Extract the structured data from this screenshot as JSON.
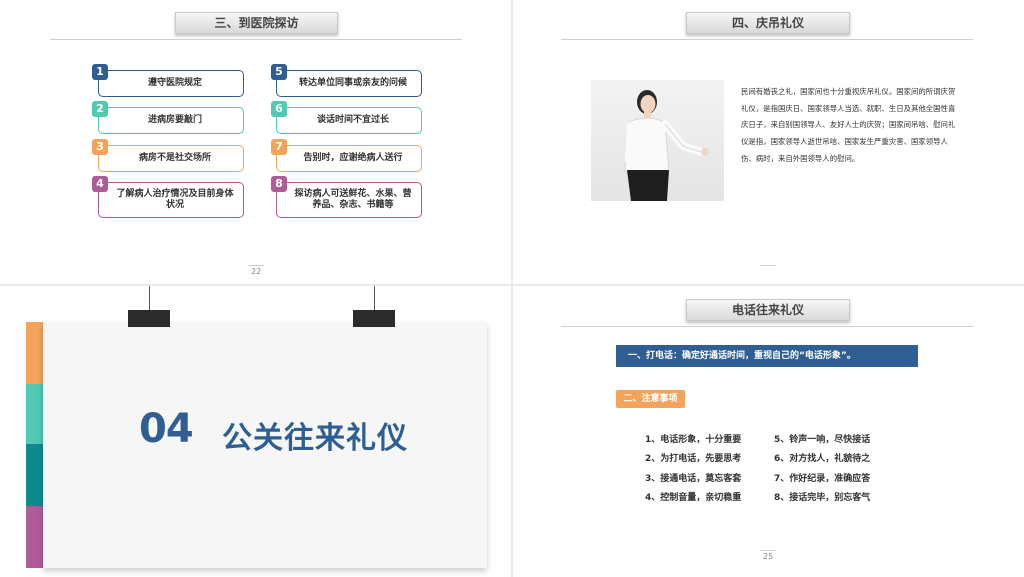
{
  "slide1": {
    "title": "三、到医院探访",
    "page": "22",
    "items": [
      {
        "num": "1",
        "text": "遵守医院规定"
      },
      {
        "num": "2",
        "text": "进病房要敲门"
      },
      {
        "num": "3",
        "text": "病房不是社交场所"
      },
      {
        "num": "4",
        "text": "了解病人治疗情况及目前身体状况"
      },
      {
        "num": "5",
        "text": "转达单位同事或亲友的问候"
      },
      {
        "num": "6",
        "text": "谈话时间不宜过长"
      },
      {
        "num": "7",
        "text": "告别时，应谢绝病人送行"
      },
      {
        "num": "8",
        "text": "探访病人可送鲜花、水果、营养品、杂志、书籍等"
      }
    ]
  },
  "slide2": {
    "title": "四、庆吊礼仪",
    "paragraph": "民间有婚丧之礼，国家间也十分重视庆吊礼仪。国家间的所谓庆贺礼仪，是指国庆日、国家领导人当选、就职、生日及其他全国性喜庆日子，来自别国领导人、友好人士的庆贺；国家间吊唁、慰问礼仪是指，国家领导人逝世吊唁、国家发生严重灾害、国家领导人伤、病时，来自外国领导人的慰问。"
  },
  "slide3": {
    "number": "04",
    "title": "公关往来礼仪",
    "stripe_colors": [
      "#f3a35a",
      "#4ecbb0",
      "#0e8a8f",
      "#b05a98"
    ]
  },
  "slide4": {
    "title": "电话往来礼仪",
    "banner": "一、打电话：确定好通话时间，重视自己的“电话形象”。",
    "note": "二、注意事项",
    "page": "25",
    "tips_left": [
      "1、电话形象，十分重要",
      "2、为打电话，先要思考",
      "3、接通电话，莫忘客套",
      "4、控制音量，亲切稳重"
    ],
    "tips_right": [
      "5、铃声一响，尽快接话",
      "6、对方找人，礼貌待之",
      "7、作好纪录，准确应答",
      "8、接话完毕，别忘客气"
    ]
  }
}
